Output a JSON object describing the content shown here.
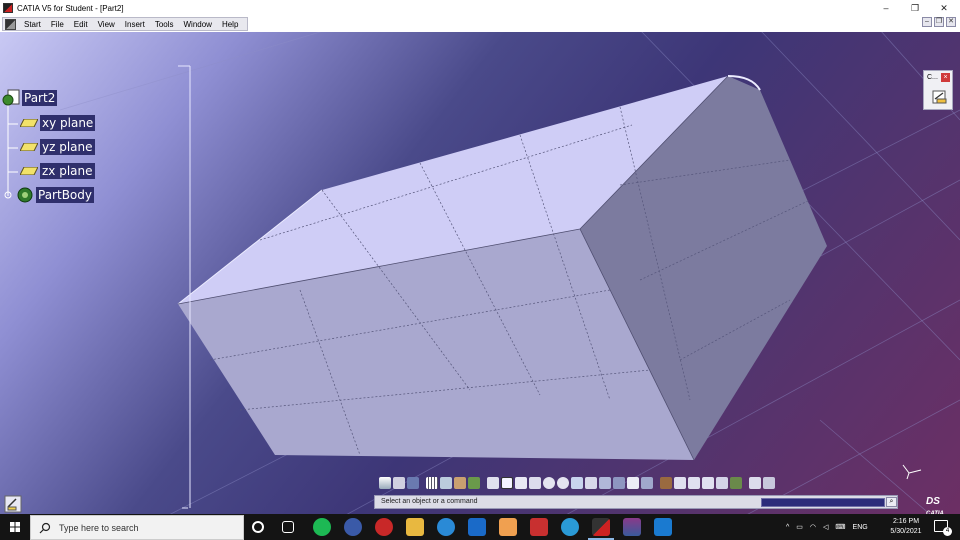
{
  "window": {
    "title": "CATIA V5 for Student - [Part2]",
    "controls": [
      "–",
      "❐",
      "✕"
    ]
  },
  "menubar": {
    "items": [
      "Start",
      "File",
      "Edit",
      "View",
      "Insert",
      "Tools",
      "Window",
      "Help"
    ]
  },
  "mdi_controls": [
    "–",
    "❐",
    "✕"
  ],
  "spec_tree": {
    "root": "Part2",
    "children": [
      "xy plane",
      "yz plane",
      "zx plane",
      "PartBody"
    ]
  },
  "compass_widget": {
    "title": "C...",
    "close": "×"
  },
  "statusbar": {
    "message": "Select an object or a command",
    "command_input": ""
  },
  "logo": {
    "brand": "DS",
    "product": "CATIA"
  },
  "toolbar": {
    "icons": [
      "formula-icon",
      "photo-icon",
      "cube-small-icon",
      "grid-icon",
      "snap-icon",
      "sketch-icon",
      "arrows-icon",
      "fly-icon",
      "fit-all-icon",
      "pan-icon",
      "rotate-icon",
      "zoom-in-icon",
      "zoom-out-icon",
      "normal-view-icon",
      "multi-view-icon",
      "iso-view-icon",
      "shading-icon",
      "hide-show-icon",
      "swap-icon",
      "apply-material-icon",
      "measure-between-icon",
      "measure-item-icon",
      "inertia-icon",
      "tools-icon",
      "catalog-icon",
      "analysis-icon",
      "more-icon"
    ]
  },
  "taskbar": {
    "search_placeholder": "Type here to search",
    "apps": [
      "cortana-icon",
      "task-view-icon",
      "spotify-icon",
      "app-icon",
      "record-icon",
      "file-explorer-icon",
      "edge-icon",
      "mail-icon",
      "app-orange-icon",
      "app-red-icon",
      "telegram-icon",
      "catia-icon",
      "winrar-icon",
      "media-player-icon"
    ],
    "language": "ENG",
    "time": "2:16 PM",
    "date": "5/30/2021",
    "notification_count": "4"
  },
  "colors": {
    "tree_label_bg": "#2f2f6c",
    "solid_top": "#cfcdf6",
    "solid_front": "#a9a8cf",
    "solid_side": "#7c7b9f"
  }
}
